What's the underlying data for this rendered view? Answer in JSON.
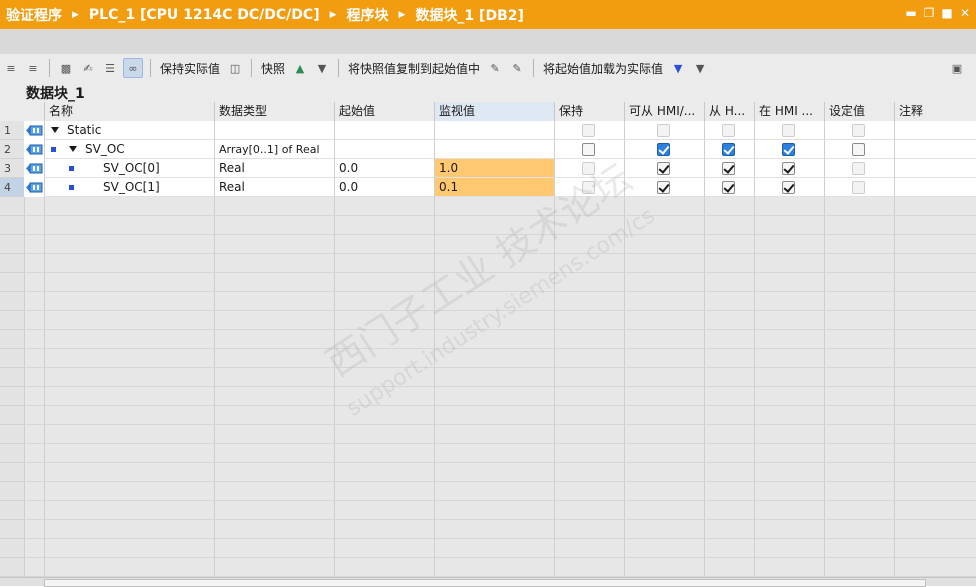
{
  "breadcrumb": [
    "验证程序",
    "PLC_1 [CPU 1214C DC/DC/DC]",
    "程序块",
    "数据块_1 [DB2]"
  ],
  "window_buttons": [
    "minimize-icon",
    "restore-icon",
    "maximize-icon",
    "close-icon"
  ],
  "toolbar": {
    "keep_actual_label": "保持实际值",
    "snapshot_label": "快照",
    "copy_snapshot_label": "将快照值复制到起始值中",
    "load_start_label": "将起始值加载为实际值"
  },
  "db_title": "数据块_1",
  "columns": [
    "名称",
    "数据类型",
    "起始值",
    "监视值",
    "保持",
    "可从 HMI/...",
    "从 H...",
    "在 HMI ...",
    "设定值",
    "注释"
  ],
  "rows": [
    {
      "num": "1",
      "name": "Static",
      "type": "",
      "start": "",
      "monitor": "",
      "expand": true,
      "indent": 0
    },
    {
      "num": "2",
      "name": "SV_OC",
      "type": "Array[0..1] of Real",
      "start": "",
      "monitor": "",
      "expand": true,
      "indent": 1
    },
    {
      "num": "3",
      "name": "SV_OC[0]",
      "type": "Real",
      "start": "0.0",
      "monitor": "1.0",
      "expand": false,
      "indent": 2
    },
    {
      "num": "4",
      "name": "SV_OC[1]",
      "type": "Real",
      "start": "0.0",
      "monitor": "0.1",
      "expand": false,
      "indent": 2
    }
  ],
  "checkbox_states": [
    {
      "retain": "off-disabled",
      "hmi_access": "off-disabled",
      "hmi_visible": "off-disabled",
      "hmi_engineering": "off-disabled",
      "setpoint": "off-disabled"
    },
    {
      "retain": "off",
      "hmi_access": "on-blue",
      "hmi_visible": "on-blue",
      "hmi_engineering": "on-blue",
      "setpoint": "off"
    },
    {
      "retain": "off-disabled",
      "hmi_access": "on",
      "hmi_visible": "on",
      "hmi_engineering": "on",
      "setpoint": "off-disabled"
    },
    {
      "retain": "off-disabled",
      "hmi_access": "on",
      "hmi_visible": "on",
      "hmi_engineering": "on",
      "setpoint": "off-disabled"
    }
  ],
  "colors": {
    "titlebar": "#f29c0f",
    "monitor_cell": "#ffc871",
    "checkbox_blue": "#2d7fe0",
    "member_bullet": "#2a4fd6"
  }
}
